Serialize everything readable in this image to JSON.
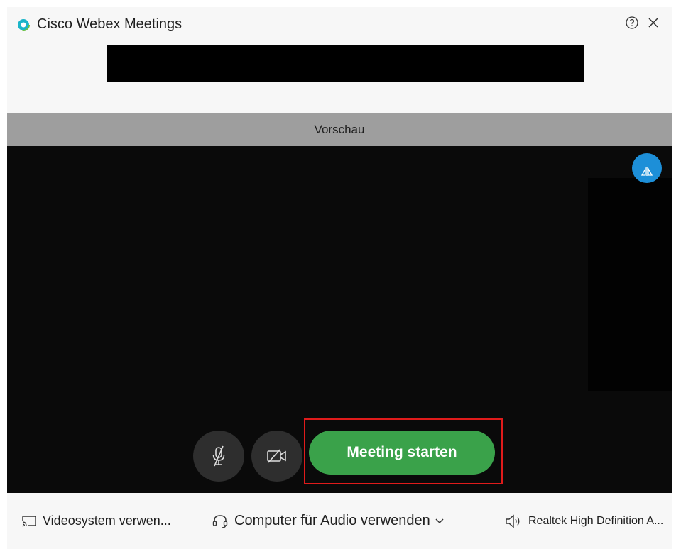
{
  "window": {
    "title": "Cisco Webex Meetings",
    "help_icon": "help-circle-icon",
    "close_icon": "close-icon"
  },
  "preview": {
    "header": "Vorschau",
    "layout_icon": "layout-toggle-icon"
  },
  "controls": {
    "mic_icon": "microphone-muted-icon",
    "camera_icon": "camera-off-icon",
    "start_label": "Meeting starten",
    "start_color": "#3aa24a",
    "highlight_color": "#e01b1b"
  },
  "bottom": {
    "video_label": "Videosystem verwen...",
    "audio_label": "Computer für Audio verwenden",
    "speaker_label": "Realtek High Definition A..."
  }
}
